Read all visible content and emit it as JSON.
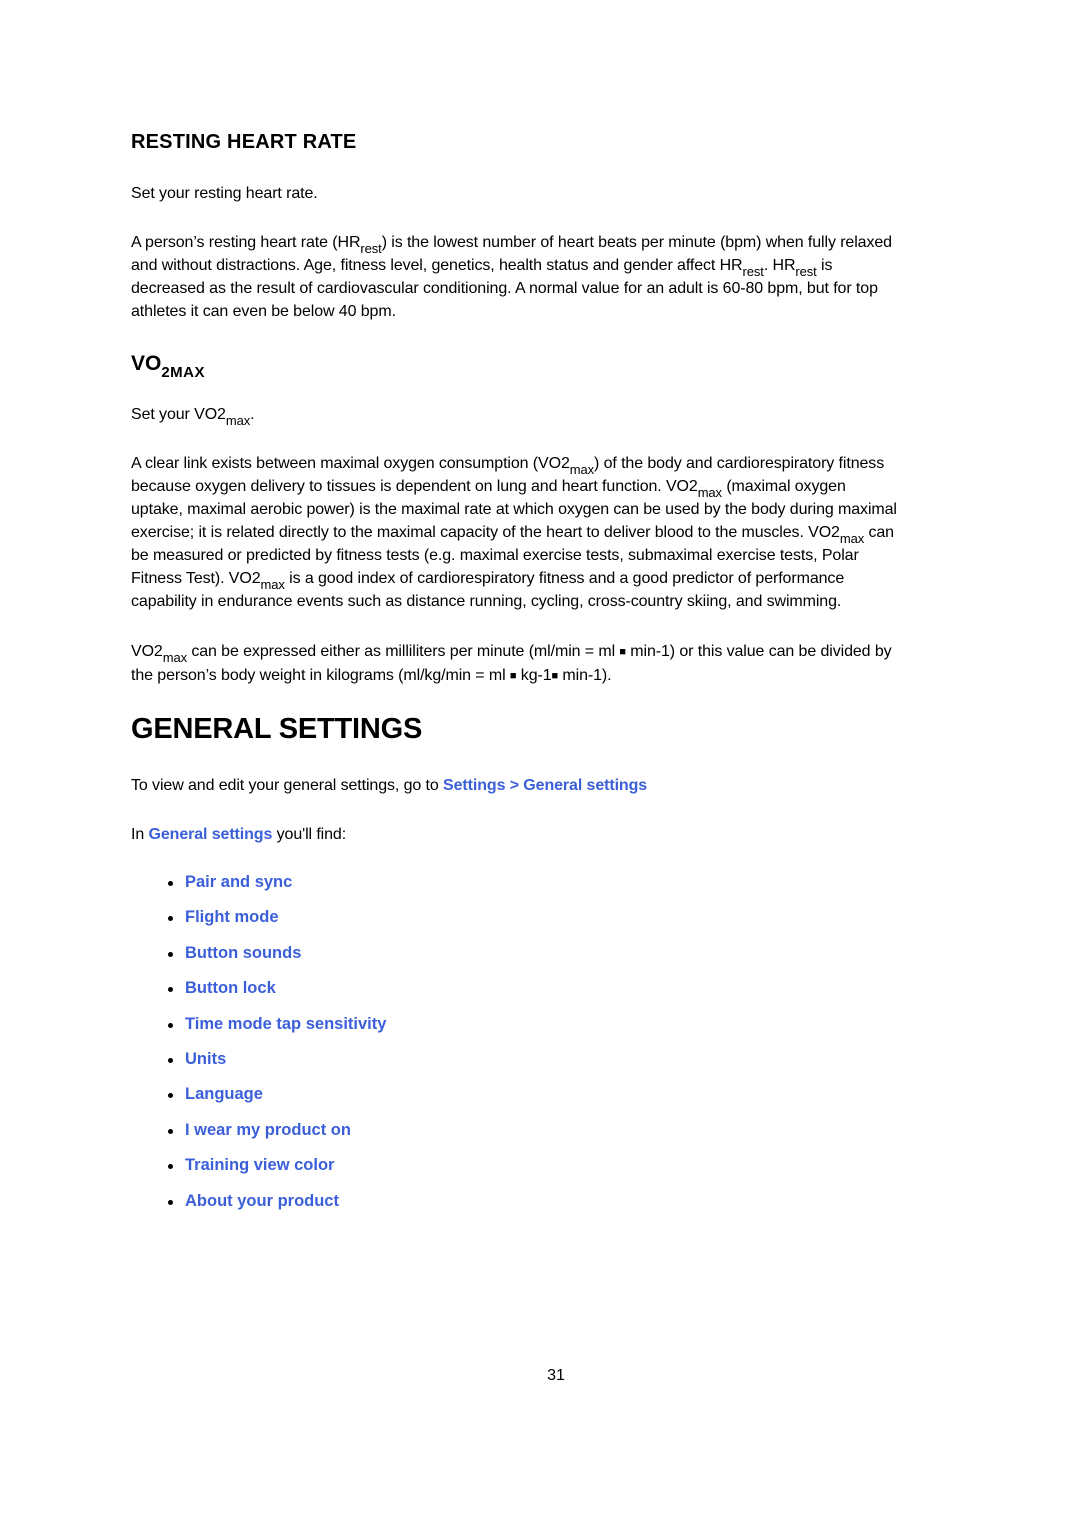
{
  "resting_hr": {
    "heading": "RESTING HEART RATE",
    "intro": "Set your resting heart rate.",
    "para": {
      "l1_a": "A person’s resting heart rate (HR",
      "l1_sub": "rest",
      "l1_b": ") is the lowest number of heart beats per minute (bpm) when fully relaxed",
      "l2_a": "and without distractions. Age, fitness level, genetics, health status and gender affect HR",
      "l2_sub1": "rest",
      "l2_b": ". HR",
      "l2_sub2": "rest",
      "l2_c": " is",
      "l3": "decreased as the result of cardiovascular conditioning. A normal value for an adult is 60-80 bpm, but for top",
      "l4": "athletes it can even be below 40 bpm."
    }
  },
  "vo2max": {
    "heading_main": "VO",
    "heading_sub": "2MAX",
    "intro_a": "Set your VO2",
    "intro_sub": "max",
    "intro_b": ".",
    "para1": {
      "l1_a": "A clear link exists between maximal oxygen consumption (VO2",
      "l1_sub": "max",
      "l1_b": ") of the body and cardiorespiratory fitness",
      "l2_a": "because oxygen delivery to tissues is dependent on lung and heart function. VO2",
      "l2_sub": "max",
      "l2_b": " (maximal oxygen",
      "l3": "uptake, maximal aerobic power) is the maximal rate at which oxygen can be used by the body during maximal",
      "l4_a": "exercise; it is related directly to the maximal capacity of the heart to deliver blood to the muscles. VO2",
      "l4_sub": "max",
      "l4_b": " can",
      "l5": "be measured or predicted by fitness tests (e.g. maximal exercise tests, submaximal exercise tests, Polar",
      "l6_a": "Fitness Test). VO2",
      "l6_sub": "max",
      "l6_b": " is a good index of cardiorespiratory fitness and a good predictor of performance",
      "l7": "capability in endurance events such as distance running, cycling, cross-country skiing, and swimming."
    },
    "para2": {
      "l1_a": "VO2",
      "l1_sub": "max",
      "l1_b": " can be expressed either as milliliters per minute (ml/min = ml ",
      "l1_sq": "■",
      "l1_c": " min-1) or this value can be divided by",
      "l2_a": "the person’s body weight in kilograms (ml/kg/min = ml ",
      "l2_sq1": "■",
      "l2_b": " kg-1",
      "l2_sq2": "■",
      "l2_c": " min-1)."
    }
  },
  "general_settings": {
    "heading": "GENERAL SETTINGS",
    "nav_text": "To view and edit your general settings, go to ",
    "nav_link": "Settings > General settings",
    "find_prefix": "In ",
    "find_link": "General settings",
    "find_suffix": " you'll find:",
    "items": [
      "Pair and sync",
      "Flight mode",
      "Button sounds",
      "Button lock",
      "Time mode tap sensitivity",
      "Units",
      "Language",
      "I wear my product on",
      "Training view color",
      "About your product"
    ]
  },
  "page_number": "31",
  "colors": {
    "link": "#3B5FD9",
    "text": "#000000"
  }
}
